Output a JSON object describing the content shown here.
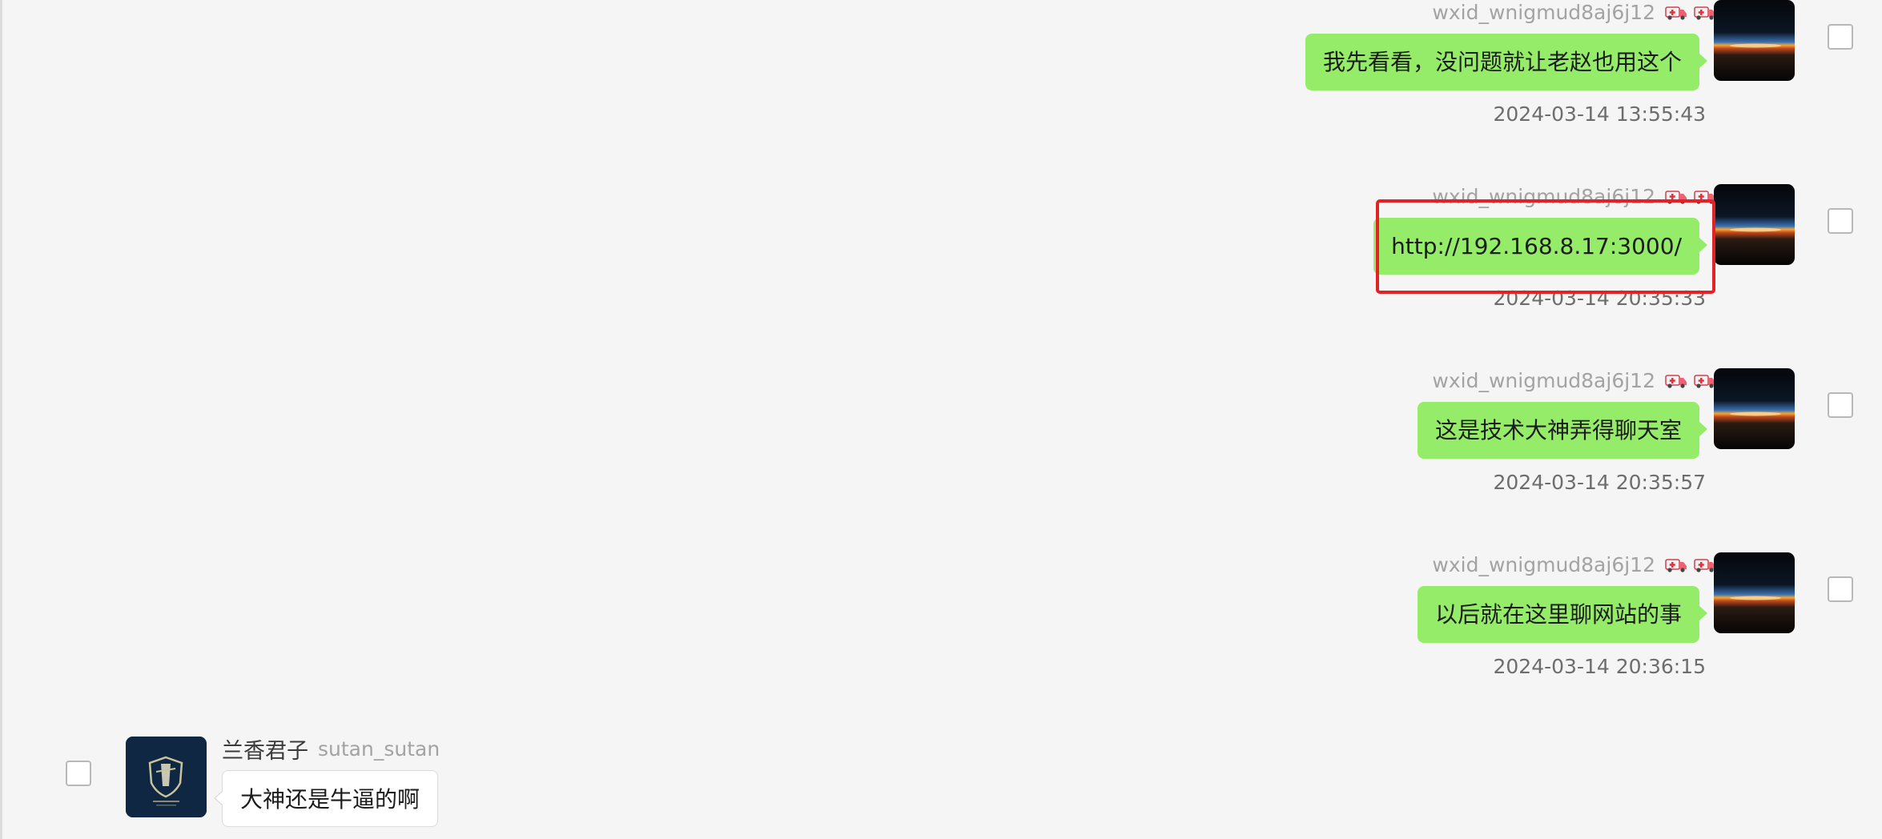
{
  "messages": [
    {
      "direction": "outgoing",
      "sender_id": "wxid_wnigmud8aj6j12",
      "badges": [
        "ambulance-emoji",
        "ambulance-emoji"
      ],
      "text": "我先看看，没问题就让老赵也用这个",
      "timestamp": "2024-03-14 13:55:43",
      "selected": false
    },
    {
      "direction": "outgoing",
      "sender_id": "wxid_wnigmud8aj6j12",
      "badges": [
        "ambulance-emoji",
        "ambulance-emoji"
      ],
      "text": "http://192.168.8.17:3000/",
      "timestamp": "2024-03-14 20:35:33",
      "selected": false,
      "highlighted": true
    },
    {
      "direction": "outgoing",
      "sender_id": "wxid_wnigmud8aj6j12",
      "badges": [
        "ambulance-emoji",
        "ambulance-emoji"
      ],
      "text": "这是技术大神弄得聊天室",
      "timestamp": "2024-03-14 20:35:57",
      "selected": false
    },
    {
      "direction": "outgoing",
      "sender_id": "wxid_wnigmud8aj6j12",
      "badges": [
        "ambulance-emoji",
        "ambulance-emoji"
      ],
      "text": "以后就在这里聊网站的事",
      "timestamp": "2024-03-14 20:36:15",
      "selected": false
    },
    {
      "direction": "incoming",
      "nickname": "兰香君子",
      "sender_id": "sutan_sutan",
      "text": "大神还是牛逼的啊",
      "selected": false
    }
  ],
  "colors": {
    "background": "#f5f5f5",
    "outgoing_bubble": "#95ec69",
    "incoming_bubble": "#ffffff",
    "highlight_border": "#e32228",
    "timestamp_text": "#6d6d6d",
    "sender_id_text": "#a3a3a3"
  },
  "icons": {
    "badge": "ambulance-emoji",
    "outgoing_avatar": "earth-horizon-sunrise-photo",
    "incoming_avatar": "shield-emblem-logo"
  }
}
